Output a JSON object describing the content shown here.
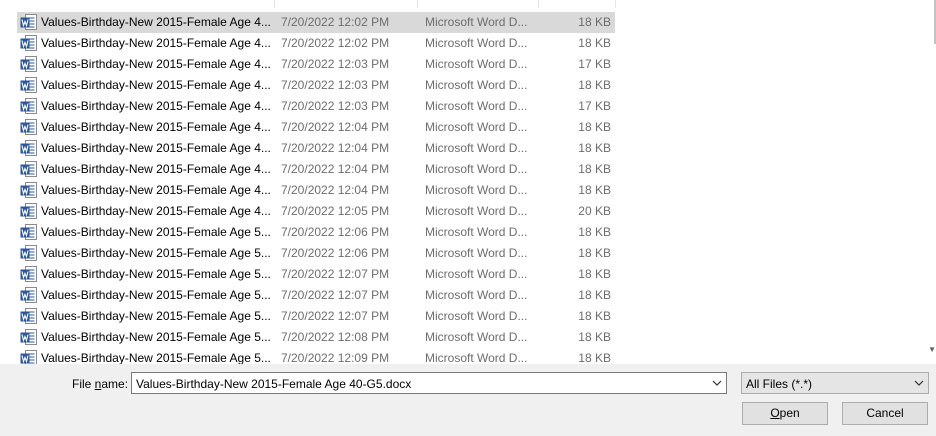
{
  "files": [
    {
      "name": "Values-Birthday-New 2015-Female Age 4...",
      "date": "7/20/2022 12:02 PM",
      "type": "Microsoft Word D...",
      "size": "18 KB",
      "selected": true
    },
    {
      "name": "Values-Birthday-New 2015-Female Age 4...",
      "date": "7/20/2022 12:02 PM",
      "type": "Microsoft Word D...",
      "size": "18 KB"
    },
    {
      "name": "Values-Birthday-New 2015-Female Age 4...",
      "date": "7/20/2022 12:03 PM",
      "type": "Microsoft Word D...",
      "size": "17 KB"
    },
    {
      "name": "Values-Birthday-New 2015-Female Age 4...",
      "date": "7/20/2022 12:03 PM",
      "type": "Microsoft Word D...",
      "size": "18 KB"
    },
    {
      "name": "Values-Birthday-New 2015-Female Age 4...",
      "date": "7/20/2022 12:03 PM",
      "type": "Microsoft Word D...",
      "size": "17 KB"
    },
    {
      "name": "Values-Birthday-New 2015-Female Age 4...",
      "date": "7/20/2022 12:04 PM",
      "type": "Microsoft Word D...",
      "size": "18 KB"
    },
    {
      "name": "Values-Birthday-New 2015-Female Age 4...",
      "date": "7/20/2022 12:04 PM",
      "type": "Microsoft Word D...",
      "size": "18 KB"
    },
    {
      "name": "Values-Birthday-New 2015-Female Age 4...",
      "date": "7/20/2022 12:04 PM",
      "type": "Microsoft Word D...",
      "size": "18 KB"
    },
    {
      "name": "Values-Birthday-New 2015-Female Age 4...",
      "date": "7/20/2022 12:04 PM",
      "type": "Microsoft Word D...",
      "size": "18 KB"
    },
    {
      "name": "Values-Birthday-New 2015-Female Age 4...",
      "date": "7/20/2022 12:05 PM",
      "type": "Microsoft Word D...",
      "size": "20 KB"
    },
    {
      "name": "Values-Birthday-New 2015-Female Age 5...",
      "date": "7/20/2022 12:06 PM",
      "type": "Microsoft Word D...",
      "size": "18 KB"
    },
    {
      "name": "Values-Birthday-New 2015-Female Age 5...",
      "date": "7/20/2022 12:06 PM",
      "type": "Microsoft Word D...",
      "size": "18 KB"
    },
    {
      "name": "Values-Birthday-New 2015-Female Age 5...",
      "date": "7/20/2022 12:07 PM",
      "type": "Microsoft Word D...",
      "size": "18 KB"
    },
    {
      "name": "Values-Birthday-New 2015-Female Age 5...",
      "date": "7/20/2022 12:07 PM",
      "type": "Microsoft Word D...",
      "size": "18 KB"
    },
    {
      "name": "Values-Birthday-New 2015-Female Age 5...",
      "date": "7/20/2022 12:07 PM",
      "type": "Microsoft Word D...",
      "size": "18 KB"
    },
    {
      "name": "Values-Birthday-New 2015-Female Age 5...",
      "date": "7/20/2022 12:08 PM",
      "type": "Microsoft Word D...",
      "size": "18 KB"
    },
    {
      "name": "Values-Birthday-New 2015-Female Age 5...",
      "date": "7/20/2022 12:09 PM",
      "type": "Microsoft Word D...",
      "size": "18 KB"
    }
  ],
  "file_icon": "word-document-icon",
  "filename": {
    "label_pre": "File ",
    "label_accel": "n",
    "label_post": "ame:",
    "value": "Values-Birthday-New 2015-Female Age 40-G5.docx"
  },
  "filter": {
    "selected": "All Files (*.*)"
  },
  "buttons": {
    "open_accel": "O",
    "open_rest": "pen",
    "cancel": "Cancel"
  },
  "colors": {
    "selected_row": "#d9d9d9",
    "word_blue": "#2b579a",
    "secondary_text": "#6d6d6d",
    "dialog_bg": "#f0f0f0"
  }
}
